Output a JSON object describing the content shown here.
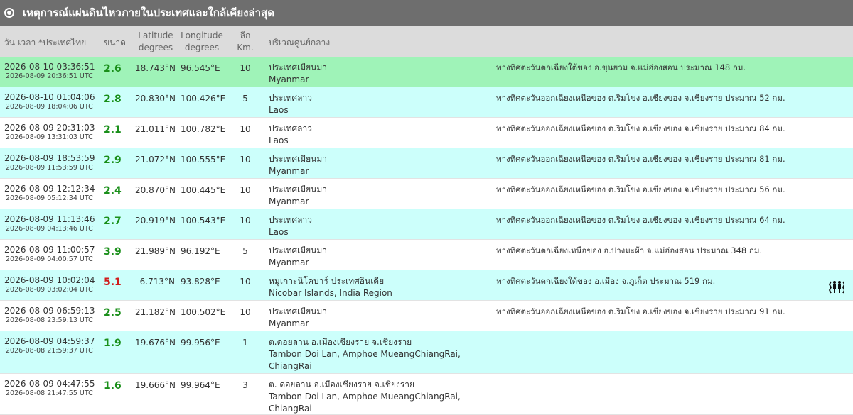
{
  "title": "เหตุการณ์แผ่นดินไหวภายในประเทศและใกล้เคียงล่าสุด",
  "header": {
    "date": "วัน-เวลา *ประเทศไทย",
    "magnitude": "ขนาด",
    "lat_1": "Latitude",
    "lat_2": "degrees",
    "lon_1": "Longitude",
    "lon_2": "degrees",
    "depth_1": "ลึก",
    "depth_2": "Km.",
    "region": "บริเวณศูนย์กลาง"
  },
  "rows": [
    {
      "date": "2026-08-10 03:36:51",
      "utc": "2026-08-09 20:36:51 UTC",
      "mag": "2.6",
      "lat": "18.743°N",
      "lon": "96.545°E",
      "depth": "10",
      "region_th": "ประเทศเมียนมา",
      "region_en": "Myanmar",
      "distance": "ทางทิศตะวันตกเฉียงใต้ของ อ.ขุนยวม จ.แม่ฮ่องสอน ประมาณ 148 กม."
    },
    {
      "date": "2026-08-10 01:04:06",
      "utc": "2026-08-09 18:04:06 UTC",
      "mag": "2.8",
      "lat": "20.830°N",
      "lon": "100.426°E",
      "depth": "5",
      "region_th": "ประเทศลาว",
      "region_en": "Laos",
      "distance": "ทางทิศตะวันออกเฉียงเหนือของ ต.ริมโขง อ.เชียงของ จ.เชียงราย ประมาณ 52 กม."
    },
    {
      "date": "2026-08-09 20:31:03",
      "utc": "2026-08-09 13:31:03 UTC",
      "mag": "2.1",
      "lat": "21.011°N",
      "lon": "100.782°E",
      "depth": "10",
      "region_th": "ประเทศลาว",
      "region_en": "Laos",
      "distance": "ทางทิศตะวันออกเฉียงเหนือของ ต.ริมโขง อ.เชียงของ จ.เชียงราย ประมาณ 84 กม."
    },
    {
      "date": "2026-08-09 18:53:59",
      "utc": "2026-08-09 11:53:59 UTC",
      "mag": "2.9",
      "lat": "21.072°N",
      "lon": "100.555°E",
      "depth": "10",
      "region_th": "ประเทศเมียนมา",
      "region_en": "Myanmar",
      "distance": "ทางทิศตะวันออกเฉียงเหนือของ ต.ริมโขง อ.เชียงของ จ.เชียงราย ประมาณ 81 กม."
    },
    {
      "date": "2026-08-09 12:12:34",
      "utc": "2026-08-09 05:12:34 UTC",
      "mag": "2.4",
      "lat": "20.870°N",
      "lon": "100.445°E",
      "depth": "10",
      "region_th": "ประเทศเมียนมา",
      "region_en": "Myanmar",
      "distance": "ทางทิศตะวันออกเฉียงเหนือของ ต.ริมโขง อ.เชียงของ จ.เชียงราย ประมาณ 56 กม."
    },
    {
      "date": "2026-08-09 11:13:46",
      "utc": "2026-08-09 04:13:46 UTC",
      "mag": "2.7",
      "lat": "20.919°N",
      "lon": "100.543°E",
      "depth": "10",
      "region_th": "ประเทศลาว",
      "region_en": "Laos",
      "distance": "ทางทิศตะวันออกเฉียงเหนือของ ต.ริมโขง อ.เชียงของ จ.เชียงราย ประมาณ 64 กม."
    },
    {
      "date": "2026-08-09 11:00:57",
      "utc": "2026-08-09 04:00:57 UTC",
      "mag": "3.9",
      "lat": "21.989°N",
      "lon": "96.192°E",
      "depth": "5",
      "region_th": "ประเทศเมียนมา",
      "region_en": "Myanmar",
      "distance": "ทางทิศตะวันตกเฉียงเหนือของ อ.ปางมะผ้า จ.แม่ฮ่องสอน ประมาณ 348 กม."
    },
    {
      "date": "2026-08-09 10:02:04",
      "utc": "2026-08-09 03:02:04 UTC",
      "mag": "5.1",
      "lat": "6.713°N",
      "lon": "93.828°E",
      "depth": "10",
      "region_th": "หมู่เกาะนิโคบาร์ ประเทศอินเดีย",
      "region_en": "Nicobar Islands, India Region",
      "distance": "ทางทิศตะวันตกเฉียงใต้ของ อ.เมือง จ.ภูเก็ต ประมาณ 519 กม.",
      "felt_icon": "felt-report-icon"
    },
    {
      "date": "2026-08-09 06:59:13",
      "utc": "2026-08-08 23:59:13 UTC",
      "mag": "2.5",
      "lat": "21.182°N",
      "lon": "100.502°E",
      "depth": "10",
      "region_th": "ประเทศเมียนมา",
      "region_en": "Myanmar",
      "distance": "ทางทิศตะวันออกเฉียงเหนือของ ต.ริมโขง อ.เชียงของ จ.เชียงราย ประมาณ 91 กม."
    },
    {
      "date": "2026-08-09 04:59:37",
      "utc": "2026-08-08 21:59:37 UTC",
      "mag": "1.9",
      "lat": "19.676°N",
      "lon": "99.956°E",
      "depth": "1",
      "region_th": "ต.ดอยลาน อ.เมืองเชียงราย จ.เชียงราย",
      "region_en": "Tambon Doi Lan, Amphoe MueangChiangRai,",
      "region_en2": "ChiangRai",
      "distance": ""
    },
    {
      "date": "2026-08-09 04:47:55",
      "utc": "2026-08-08 21:47:55 UTC",
      "mag": "1.6",
      "lat": "19.666°N",
      "lon": "99.964°E",
      "depth": "3",
      "region_th": "ต. ดอยลาน อ.เมืองเชียงราย จ.เชียงราย",
      "region_en": "Tambon Doi Lan, Amphoe MueangChiangRai,",
      "region_en2": "ChiangRai",
      "distance": ""
    }
  ],
  "colors": {
    "title_bg": "#6e6e6e",
    "header_bg": "#dcdcdc",
    "row_latest": "#9ff3b8",
    "row_alt": "#ccfffb",
    "mag_normal": "#1a8f1a",
    "mag_high": "#d01c1c"
  }
}
